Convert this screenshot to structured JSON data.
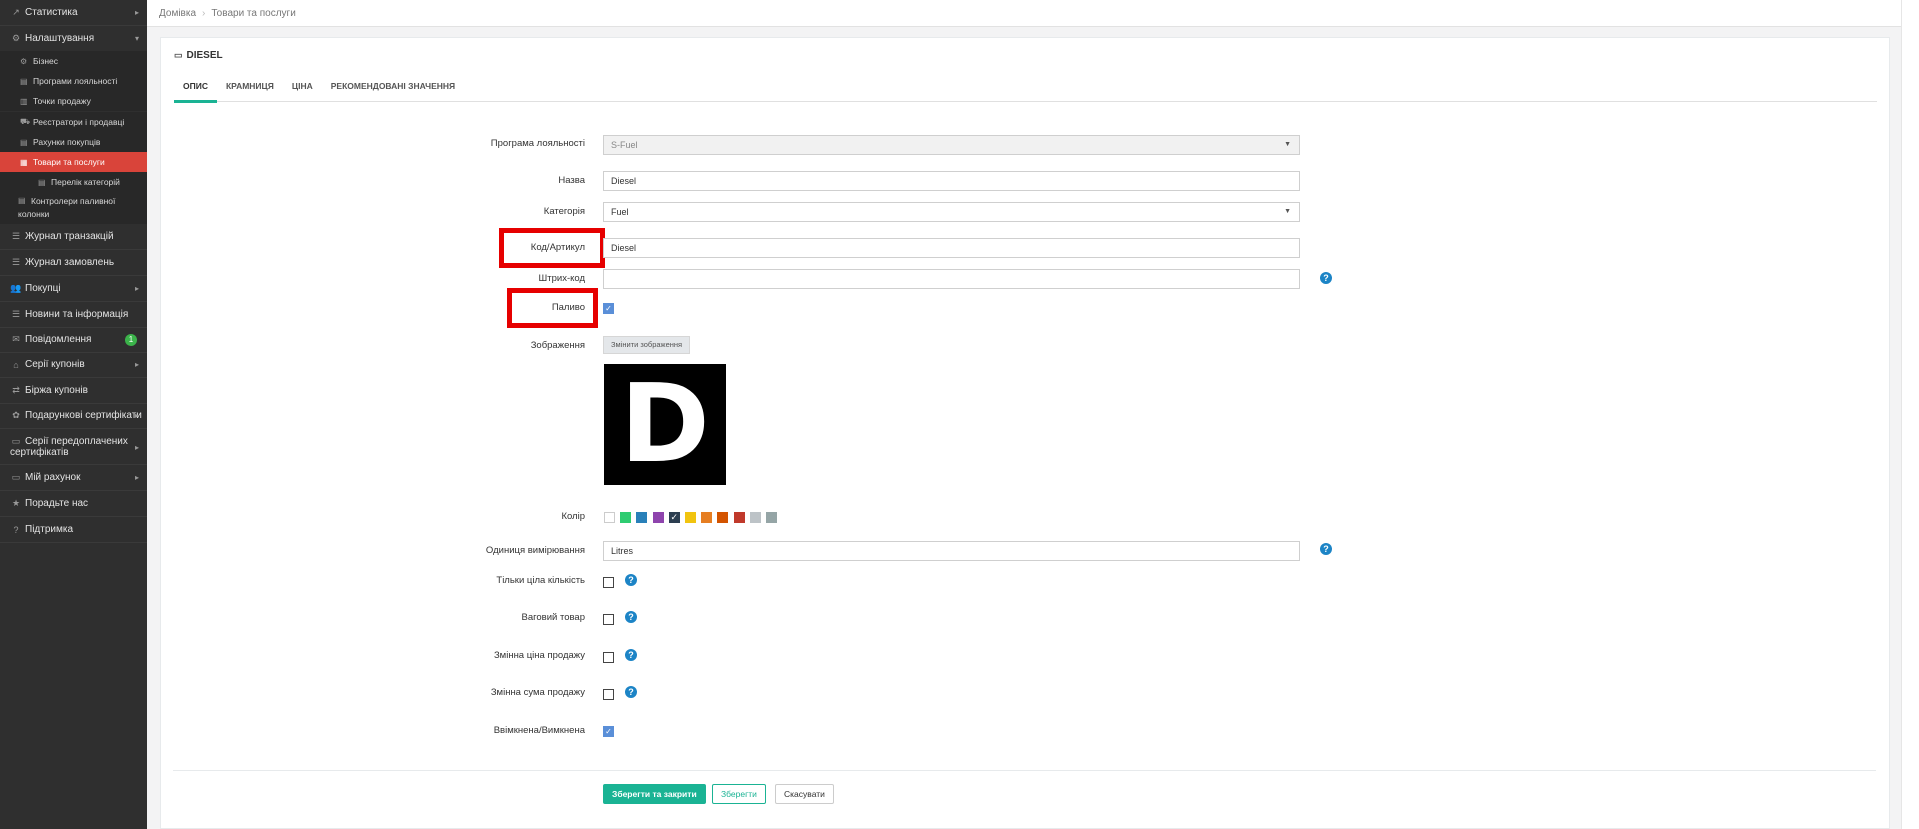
{
  "sidebar": {
    "top_items": [
      {
        "label": "Статистика",
        "icon": "chart-icon"
      },
      {
        "label": "Налаштування",
        "icon": "gear-icon"
      }
    ],
    "sub_items": [
      {
        "label": "Бізнес"
      },
      {
        "label": "Програми лояльності"
      },
      {
        "label": "Точки продажу"
      },
      {
        "label": "Реєстратори і продавці"
      },
      {
        "label": "Рахунки покупців"
      },
      {
        "label": "Товари та послуги"
      },
      {
        "label": "Перелік категорій"
      },
      {
        "label": "Контролери паливної"
      },
      {
        "label": "колонки"
      }
    ],
    "items": [
      {
        "label": "Журнал транзакцій"
      },
      {
        "label": "Журнал замовлень"
      },
      {
        "label": "Покупці"
      },
      {
        "label": "Новини та інформація"
      },
      {
        "label": "Повідомлення",
        "badge": "1"
      },
      {
        "label": "Серії купонів"
      },
      {
        "label": "Біржа купонів"
      },
      {
        "label": "Подарункові сертифікати"
      },
      {
        "label": "Серії передоплачених"
      },
      {
        "label": "сертифікатів"
      },
      {
        "label": "Мій рахунок"
      },
      {
        "label": "Порадьте нас"
      },
      {
        "label": "Підтримка"
      }
    ]
  },
  "breadcrumb": {
    "home": "Домівка",
    "current": "Товари та послуги"
  },
  "card": {
    "title": "DIESEL"
  },
  "tabs": [
    "ОПИС",
    "КРАМНИЦЯ",
    "ЦІНА",
    "РЕКОМЕНДОВАНІ ЗНАЧЕННЯ"
  ],
  "form": {
    "loyalty_label": "Програма лояльності",
    "loyalty_value": "S-Fuel",
    "name_label": "Назва",
    "name_value": "Diesel",
    "category_label": "Категорія",
    "category_value": "Fuel",
    "code_label": "Код/Артикул",
    "code_value": "Diesel",
    "barcode_label": "Штрих-код",
    "barcode_value": "",
    "fuel_label": "Паливо",
    "fuel_checked": true,
    "image_label": "Зображення",
    "image_button": "Змінити зображення",
    "image_letter": "D",
    "color_label": "Колір",
    "colors": [
      "#ffffff",
      "#2ecc71",
      "#2980b9",
      "#8e44ad",
      "#2c3e50",
      "#f1c40f",
      "#e67e22",
      "#d35400",
      "#c0392b",
      "#bdc3c7",
      "#95a5a6"
    ],
    "selected_color_index": 4,
    "unit_label": "Одиниця вимірювання",
    "unit_value": "Litres",
    "whole_qty_label": "Тільки ціла кількість",
    "weight_label": "Ваговий товар",
    "variable_price_label": "Змінна ціна продажу",
    "variable_sum_label": "Змінна сума продажу",
    "enabled_label": "Ввімкнена/Вимкнена",
    "enabled_checked": true
  },
  "buttons": {
    "save_close": "Зберегти та закрити",
    "save": "Зберегти",
    "cancel": "Скасувати"
  }
}
